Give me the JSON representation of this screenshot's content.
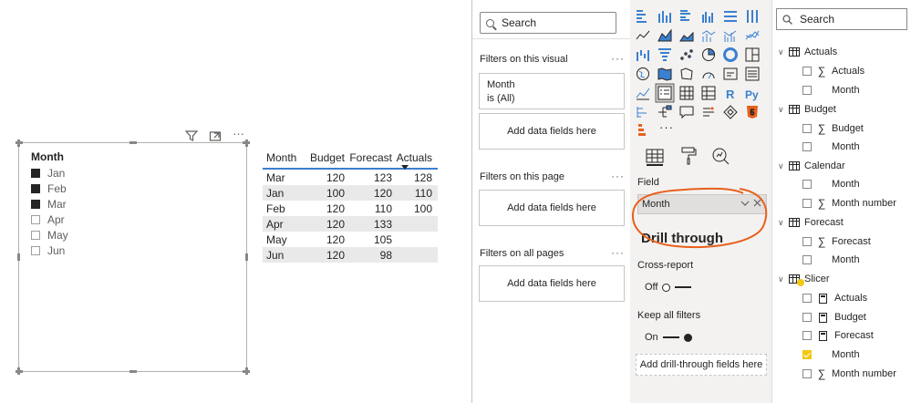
{
  "canvas": {
    "slicer": {
      "title": "Month",
      "items": [
        {
          "label": "Jan",
          "checked": true
        },
        {
          "label": "Feb",
          "checked": true
        },
        {
          "label": "Mar",
          "checked": true
        },
        {
          "label": "Apr",
          "checked": false
        },
        {
          "label": "May",
          "checked": false
        },
        {
          "label": "Jun",
          "checked": false
        }
      ],
      "header_icons": [
        "filter-icon",
        "focus-mode-icon",
        "more-options-icon"
      ],
      "more_label": "···"
    },
    "table": {
      "columns": [
        "Month",
        "Budget",
        "Forecast",
        "Actuals"
      ],
      "sorted_column": "Actuals",
      "rows": [
        [
          "Mar",
          "120",
          "123",
          "128"
        ],
        [
          "Jan",
          "100",
          "120",
          "110"
        ],
        [
          "Feb",
          "120",
          "110",
          "100"
        ],
        [
          "Apr",
          "120",
          "133",
          ""
        ],
        [
          "May",
          "120",
          "105",
          ""
        ],
        [
          "Jun",
          "120",
          "98",
          ""
        ]
      ]
    }
  },
  "filters": {
    "search_placeholder": "Search",
    "on_visual": "Filters on this visual",
    "month_card": {
      "name": "Month",
      "state": "is (All)"
    },
    "add_fields": "Add data fields here",
    "on_page": "Filters on this page",
    "on_all_pages": "Filters on all pages",
    "more": "···"
  },
  "visualizations": {
    "field_label": "Field",
    "field_value": "Month",
    "drill_through": "Drill through",
    "cross_report": "Cross-report",
    "cross_report_state": "Off",
    "keep_filters": "Keep all filters",
    "keep_filters_state": "On",
    "add_drill": "Add drill-through fields here",
    "more": "···",
    "r_label": "R",
    "py_label": "Py",
    "annotation_color": "#e8601c"
  },
  "fields": {
    "search_placeholder": "Search",
    "tables": [
      {
        "name": "Actuals",
        "items": [
          {
            "label": "Actuals",
            "type": "sum",
            "checked": false
          },
          {
            "label": "Month",
            "type": "plain",
            "checked": false
          }
        ]
      },
      {
        "name": "Budget",
        "items": [
          {
            "label": "Budget",
            "type": "sum",
            "checked": false
          },
          {
            "label": "Month",
            "type": "plain",
            "checked": false
          }
        ]
      },
      {
        "name": "Calendar",
        "items": [
          {
            "label": "Month",
            "type": "plain",
            "checked": false
          },
          {
            "label": "Month number",
            "type": "sum",
            "checked": false
          }
        ]
      },
      {
        "name": "Forecast",
        "items": [
          {
            "label": "Forecast",
            "type": "sum",
            "checked": false
          },
          {
            "label": "Month",
            "type": "plain",
            "checked": false
          }
        ]
      },
      {
        "name": "Slicer",
        "items": [
          {
            "label": "Actuals",
            "type": "calc",
            "checked": false
          },
          {
            "label": "Budget",
            "type": "calc",
            "checked": false
          },
          {
            "label": "Forecast",
            "type": "calc",
            "checked": false
          },
          {
            "label": "Month",
            "type": "plain",
            "checked": true
          },
          {
            "label": "Month number",
            "type": "sum",
            "checked": false
          }
        ]
      }
    ]
  }
}
